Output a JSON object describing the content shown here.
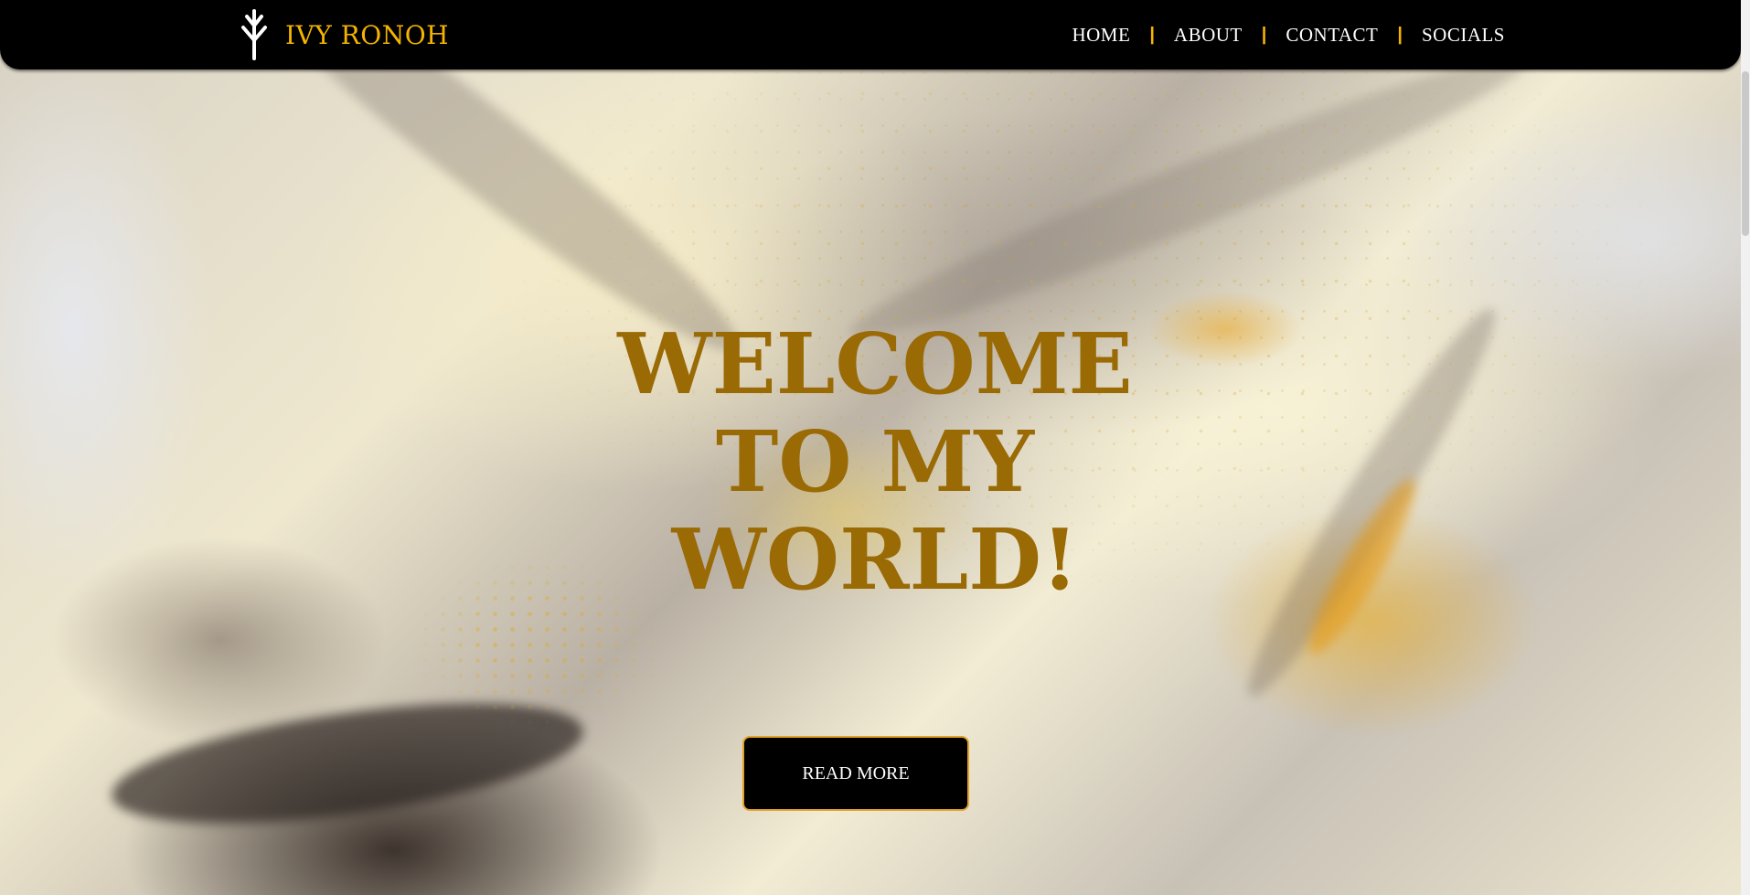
{
  "header": {
    "brand_name": "IVY RONOH",
    "nav": [
      {
        "label": "HOME"
      },
      {
        "label": "ABOUT"
      },
      {
        "label": "CONTACT"
      },
      {
        "label": "SOCIALS"
      }
    ],
    "separator": "|"
  },
  "hero": {
    "title_lines": [
      "WELCOME",
      "TO MY",
      "WORLD!"
    ],
    "cta_label": "READ MORE"
  },
  "colors": {
    "brand_gold": "#f5b400",
    "title_brown": "#9a6a05",
    "navbar_bg": "#000000",
    "button_border": "#e2a227"
  },
  "icons": {
    "logo": "arrow-tree-logo-icon"
  }
}
